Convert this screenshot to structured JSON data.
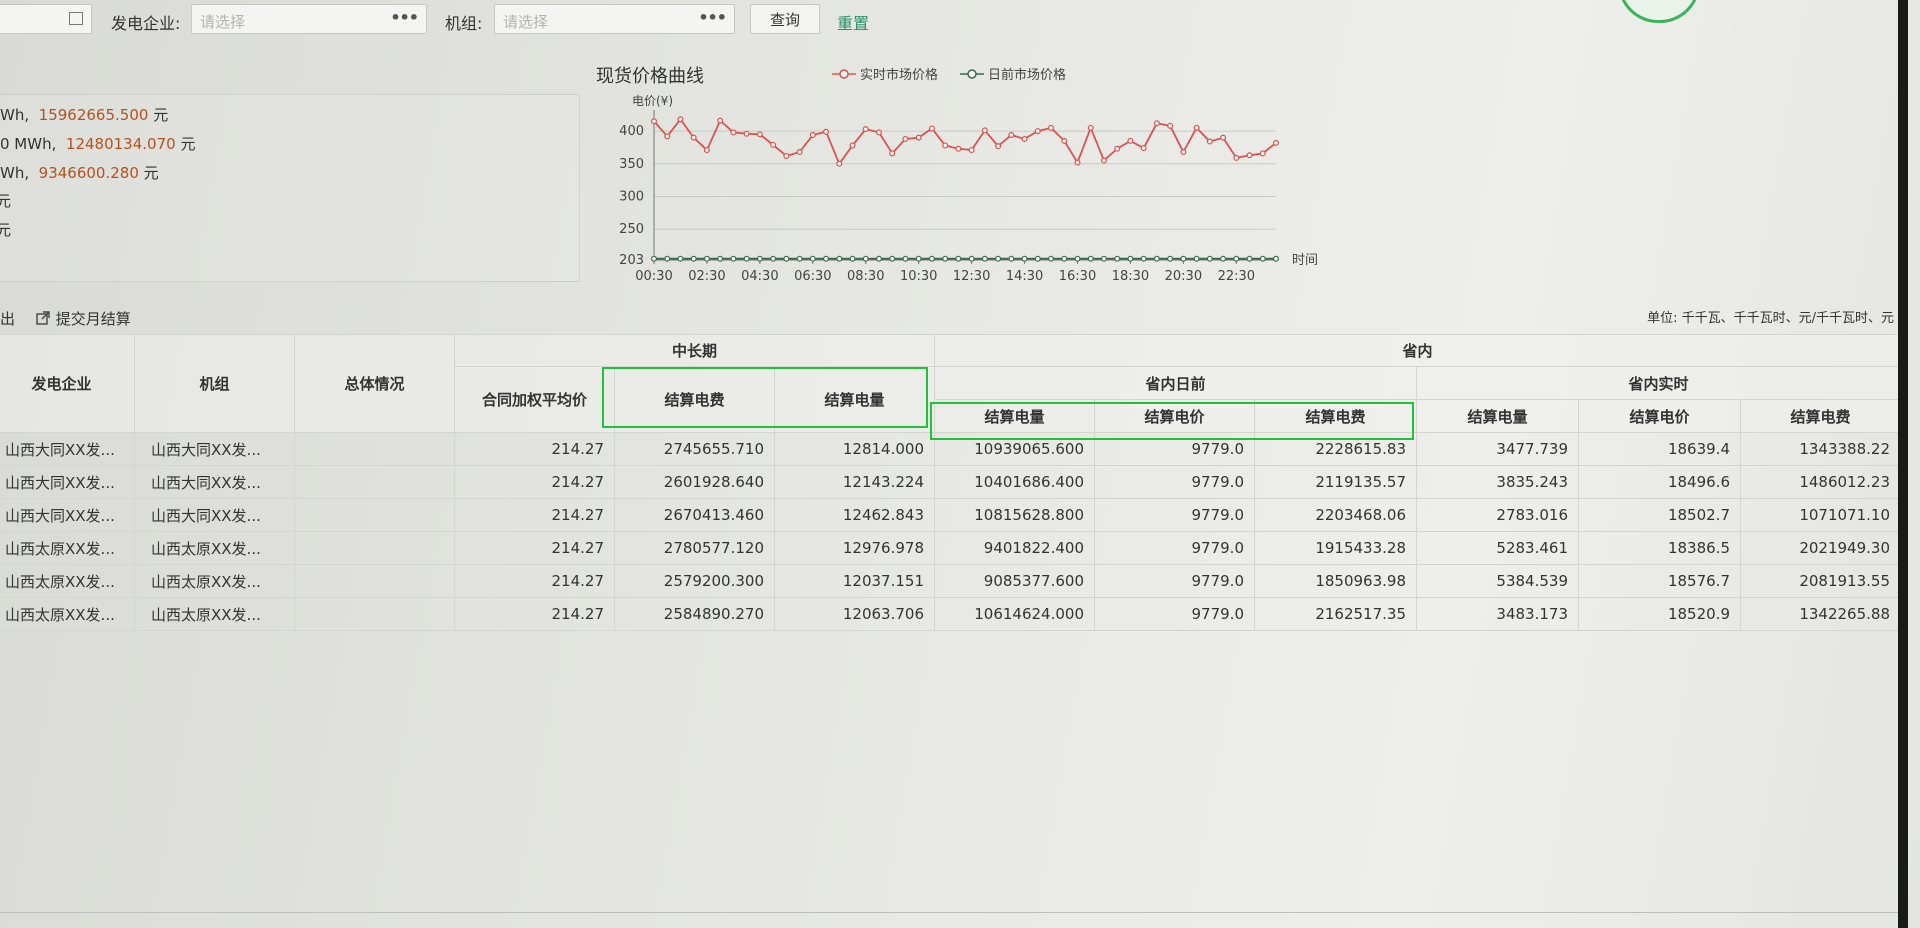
{
  "filters": {
    "company_label": "发电企业:",
    "company_placeholder": "请选择",
    "unit_label": "机组:",
    "unit_placeholder": "请选择",
    "dots": "•••",
    "query_button": "查询",
    "reset_button": "重置"
  },
  "summary": {
    "lines": [
      {
        "prefix": "Wh,",
        "value": "15962665.500",
        "suffix": "元"
      },
      {
        "prefix": "0 MWh,",
        "value": "12480134.070",
        "suffix": "元"
      },
      {
        "prefix": "Wh,",
        "value": "9346600.280",
        "suffix": "元"
      },
      {
        "prefix": "元",
        "value": "",
        "suffix": ""
      },
      {
        "prefix": "元",
        "value": "",
        "suffix": ""
      }
    ]
  },
  "chart_data": {
    "type": "line",
    "title": "现货价格曲线",
    "ylabel": "电价(¥)",
    "xlabel": "时间",
    "ylim": [
      203,
      420
    ],
    "yticks": [
      "400",
      "350",
      "300",
      "250",
      "203"
    ],
    "xticks": [
      "00:30",
      "02:30",
      "04:30",
      "06:30",
      "08:30",
      "10:30",
      "12:30",
      "14:30",
      "16:30",
      "18:30",
      "20:30",
      "22:30"
    ],
    "categories": [
      "00:30",
      "01:00",
      "01:30",
      "02:00",
      "02:30",
      "03:00",
      "03:30",
      "04:00",
      "04:30",
      "05:00",
      "05:30",
      "06:00",
      "06:30",
      "07:00",
      "07:30",
      "08:00",
      "08:30",
      "09:00",
      "09:30",
      "10:00",
      "10:30",
      "11:00",
      "11:30",
      "12:00",
      "12:30",
      "13:00",
      "13:30",
      "14:00",
      "14:30",
      "15:00",
      "15:30",
      "16:00",
      "16:30",
      "17:00",
      "17:30",
      "18:00",
      "18:30",
      "19:00",
      "19:30",
      "20:00",
      "20:30",
      "21:00",
      "21:30",
      "22:00",
      "22:30",
      "23:00",
      "23:30",
      "24:00"
    ],
    "series": [
      {
        "name": "实时市场价格",
        "color": "#d9534f",
        "values": [
          415,
          392,
          418,
          390,
          371,
          416,
          398,
          396,
          395,
          379,
          362,
          368,
          394,
          399,
          350,
          378,
          403,
          398,
          366,
          388,
          390,
          404,
          378,
          373,
          371,
          401,
          377,
          394,
          388,
          400,
          405,
          385,
          352,
          405,
          355,
          373,
          385,
          374,
          412,
          408,
          368,
          405,
          384,
          390,
          359,
          363,
          366,
          382
        ]
      },
      {
        "name": "日前市场价格",
        "color": "#3a6b4a",
        "values": [
          205,
          205,
          205,
          205,
          205,
          205,
          205,
          205,
          205,
          205,
          205,
          205,
          205,
          205,
          205,
          205,
          205,
          205,
          205,
          205,
          205,
          205,
          205,
          205,
          205,
          205,
          205,
          205,
          205,
          205,
          205,
          205,
          205,
          205,
          205,
          205,
          205,
          205,
          205,
          205,
          205,
          205,
          205,
          205,
          205,
          205,
          205,
          205
        ]
      }
    ]
  },
  "toolbar": {
    "export_label": "出",
    "submit_label": "提交月结算",
    "unit_note": "单位: 千千瓦、千千瓦时、元/千千瓦时、元"
  },
  "table": {
    "group_mid": "中长期",
    "group_prov": "省内",
    "group_dayahead": "省内日前",
    "group_realtime": "省内实时",
    "col_company": "发电企业",
    "col_unit": "机组",
    "col_overall": "总体情况",
    "col_avg_price": "合同加权平均价",
    "col_mid_fee": "结算电费",
    "col_mid_qty": "结算电量",
    "col_da_qty": "结算电量",
    "col_da_price": "结算电价",
    "col_da_fee": "结算电费",
    "col_rt_qty": "结算电量",
    "col_rt_price": "结算电价",
    "col_rt_fee": "结算电费",
    "rows": [
      {
        "company": "山西大同XX发...",
        "unit": "山西大同XX发...",
        "overall": "",
        "avg": "214.27",
        "mid_fee": "2745655.710",
        "mid_qty": "12814.000",
        "da_qty": "10939065.600",
        "da_price": "9779.0",
        "da_fee": "2228615.83",
        "rt_qty": "3477.739",
        "rt_price": "18639.4",
        "rt_fee": "1343388.22"
      },
      {
        "company": "山西大同XX发...",
        "unit": "山西大同XX发...",
        "overall": "",
        "avg": "214.27",
        "mid_fee": "2601928.640",
        "mid_qty": "12143.224",
        "da_qty": "10401686.400",
        "da_price": "9779.0",
        "da_fee": "2119135.57",
        "rt_qty": "3835.243",
        "rt_price": "18496.6",
        "rt_fee": "1486012.23"
      },
      {
        "company": "山西大同XX发...",
        "unit": "山西大同XX发...",
        "overall": "",
        "avg": "214.27",
        "mid_fee": "2670413.460",
        "mid_qty": "12462.843",
        "da_qty": "10815628.800",
        "da_price": "9779.0",
        "da_fee": "2203468.06",
        "rt_qty": "2783.016",
        "rt_price": "18502.7",
        "rt_fee": "1071071.10"
      },
      {
        "company": "山西太原XX发...",
        "unit": "山西太原XX发...",
        "overall": "",
        "avg": "214.27",
        "mid_fee": "2780577.120",
        "mid_qty": "12976.978",
        "da_qty": "9401822.400",
        "da_price": "9779.0",
        "da_fee": "1915433.28",
        "rt_qty": "5283.461",
        "rt_price": "18386.5",
        "rt_fee": "2021949.30"
      },
      {
        "company": "山西太原XX发...",
        "unit": "山西太原XX发...",
        "overall": "",
        "avg": "214.27",
        "mid_fee": "2579200.300",
        "mid_qty": "12037.151",
        "da_qty": "9085377.600",
        "da_price": "9779.0",
        "da_fee": "1850963.98",
        "rt_qty": "5384.539",
        "rt_price": "18576.7",
        "rt_fee": "2081913.55"
      },
      {
        "company": "山西太原XX发...",
        "unit": "山西太原XX发...",
        "overall": "",
        "avg": "214.27",
        "mid_fee": "2584890.270",
        "mid_qty": "12063.706",
        "da_qty": "10614624.000",
        "da_price": "9779.0",
        "da_fee": "2162517.35",
        "rt_qty": "3483.173",
        "rt_price": "18520.9",
        "rt_fee": "1342265.88"
      }
    ]
  },
  "colors": {
    "accent": "#2a8f6b",
    "highlight": "#22c13a",
    "value": "#b4521f"
  }
}
